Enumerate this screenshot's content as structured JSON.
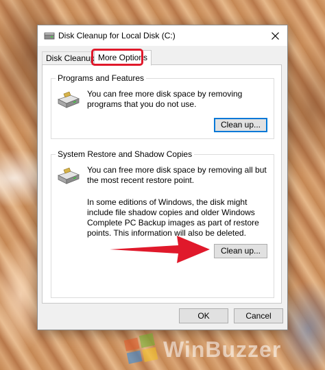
{
  "window": {
    "title": "Disk Cleanup for Local Disk (C:)",
    "close_glyph": "✕"
  },
  "tabs": [
    {
      "label": "Disk Cleanup",
      "active": false
    },
    {
      "label": "More Options",
      "active": true
    }
  ],
  "programs_group": {
    "title": "Programs and Features",
    "description": "You can free more disk space by removing programs that you do not use.",
    "button_label": "Clean up..."
  },
  "restore_group": {
    "title": "System Restore and Shadow Copies",
    "description": "You can free more disk space by removing all but the most recent restore point.",
    "note": "In some editions of Windows, the disk might include file shadow copies and older Windows Complete PC Backup images as part of restore points. This information will also be deleted.",
    "button_label": "Clean up..."
  },
  "footer": {
    "ok_label": "OK",
    "cancel_label": "Cancel"
  },
  "annotation": {
    "highlight_color": "#e0192b",
    "arrow_color": "#e0192b"
  },
  "watermark": {
    "text": "WinBuzzer"
  }
}
